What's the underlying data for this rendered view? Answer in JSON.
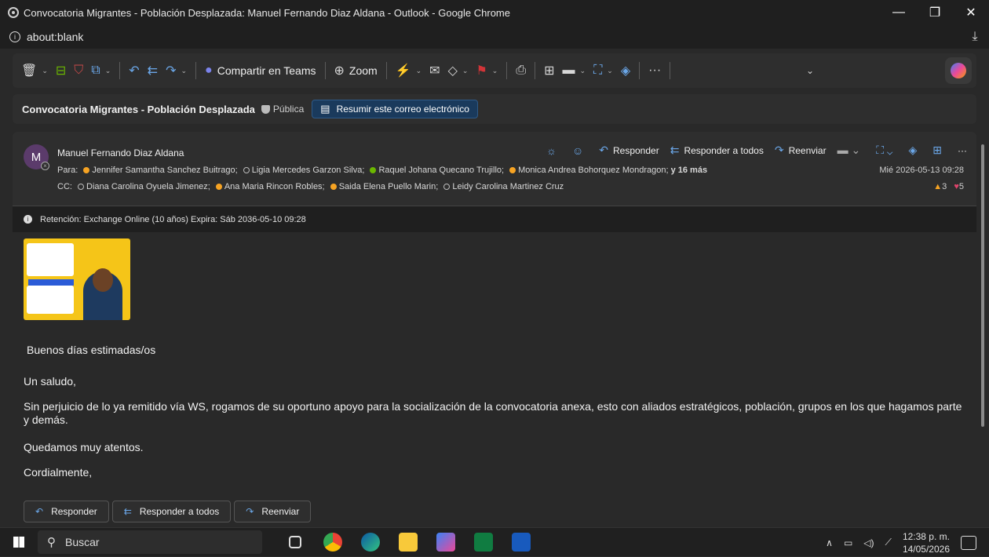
{
  "window": {
    "title": "Convocatoria Migrantes - Población Desplazada: Manuel Fernando Diaz Aldana - Outlook - Google Chrome",
    "minimize": "—",
    "restore": "❐",
    "close": "✕"
  },
  "address": {
    "url": "about:blank"
  },
  "toolbar": {
    "share_teams": "Compartir en Teams",
    "zoom": "Zoom",
    "more": "···"
  },
  "subject": {
    "title": "Convocatoria Migrantes - Población Desplazada",
    "sensitivity": "Pública",
    "summarize": "Resumir este correo electrónico"
  },
  "message": {
    "avatar_initial": "M",
    "sender": "Manuel Fernando Diaz Aldana",
    "to_prefix": "Para:",
    "to": [
      "Jennifer Samantha Sanchez Buitrago;",
      "Ligia Mercedes Garzon Silva;",
      "Raquel Johana Quecano Trujillo;",
      "Monica Andrea Bohorquez Mondragon;"
    ],
    "to_more": "y 16 más",
    "cc_prefix": "CC:",
    "cc": [
      "Diana Carolina Oyuela Jimenez;",
      "Ana Maria Rincon Robles;",
      "Saida Elena Puello Marin;",
      "Leidy Carolina Martinez Cruz"
    ],
    "reply": "Responder",
    "reply_all": "Responder a todos",
    "forward": "Reenviar",
    "date": "Mié 2026-05-13 09:28",
    "likes": "3",
    "hearts": "5"
  },
  "retention": "Retención: Exchange Online (10 años) Expira: Sáb 2036-05-10 09:28",
  "body": {
    "greeting": "Buenos días estimadas/os",
    "salute": "Un saludo,",
    "paragraph": "Sin perjuicio de lo ya remitido vía WS, rogamos de su oportuno apoyo para la socialización de la convocatoria anexa, esto con aliados estratégicos, población, grupos en los que hagamos parte y demás.",
    "closing1": "Quedamos muy atentos.",
    "closing2": "Cordialmente,",
    "poster_text": "¡TE ESTAMOS BUSCANDO!"
  },
  "bottom_buttons": {
    "reply": "Responder",
    "reply_all": "Responder a todos",
    "forward": "Reenviar"
  },
  "taskbar": {
    "search": "Buscar",
    "time": "12:38 p. m.",
    "date": "14/05/2026"
  },
  "colors": {
    "accent": "#6ba7e8",
    "summarize_bg": "#1a3a5c",
    "presence_away": "#f6a323",
    "presence_available": "#6bb700"
  }
}
